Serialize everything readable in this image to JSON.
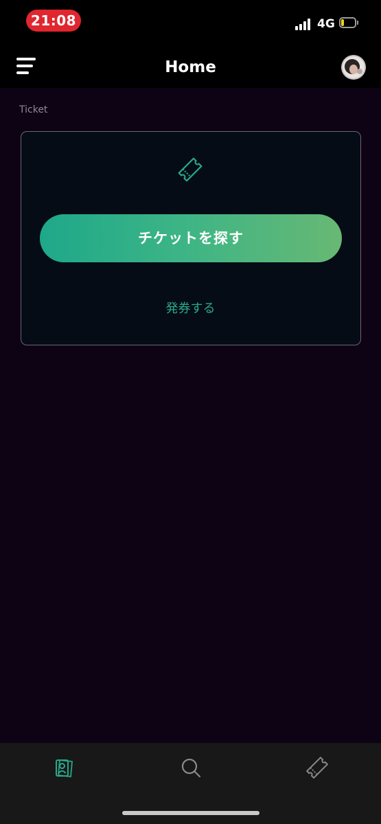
{
  "status_bar": {
    "time": "21:08",
    "network": "4G",
    "battery_level": 0.2,
    "colors": {
      "time_pill": "#e0262f",
      "battery_level": "#f2d21a"
    }
  },
  "header": {
    "title": "Home",
    "menu_icon": "hamburger-menu-icon",
    "avatar_icon": "user-avatar"
  },
  "ticket_section": {
    "label": "Ticket",
    "icon": "ticket-icon",
    "find_button_label": "チケットを探す",
    "issue_link_label": "発券する"
  },
  "tab_bar": {
    "tabs": [
      {
        "icon": "tickets-tab-icon",
        "active": true
      },
      {
        "icon": "search-icon",
        "active": false
      },
      {
        "icon": "ticket-icon",
        "active": false
      }
    ]
  },
  "colors": {
    "background": "#0e0314",
    "header": "#000000",
    "accent": "#2aa88a",
    "gradient_start": "#1ea88a",
    "gradient_end": "#68b873",
    "card": "#050c16",
    "tab_bar": "#181818",
    "inactive_icon": "#8a8a8a"
  }
}
